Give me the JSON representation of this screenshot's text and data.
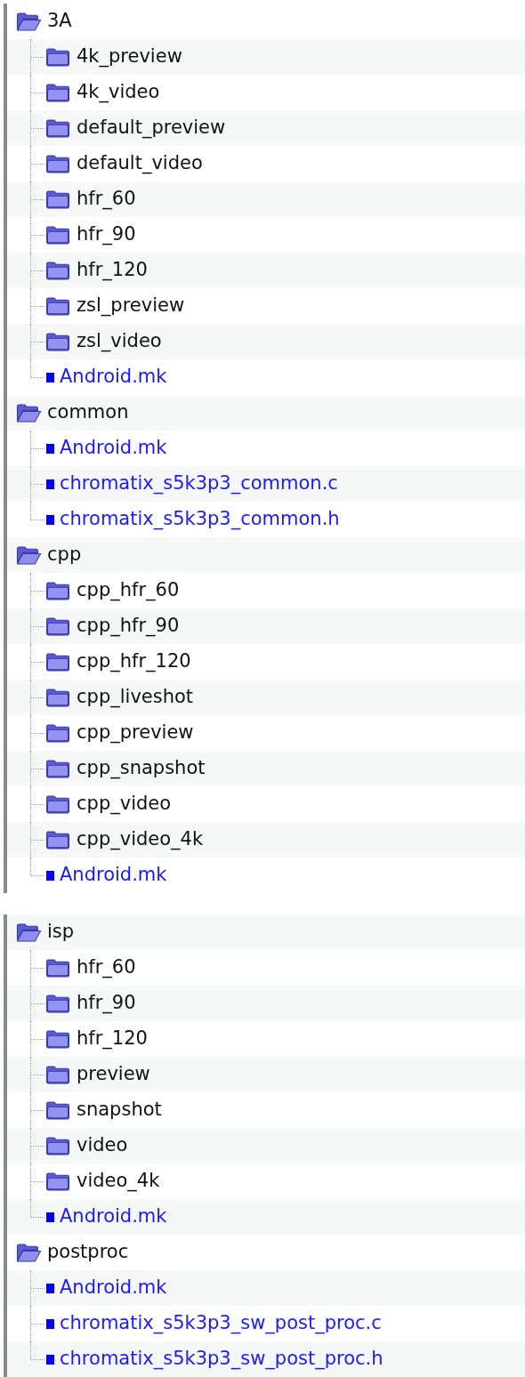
{
  "panels": [
    {
      "items": [
        {
          "name": "3A",
          "kind": "folder",
          "expanded": true,
          "children": [
            {
              "name": "4k_preview",
              "kind": "folder",
              "expanded": false
            },
            {
              "name": "4k_video",
              "kind": "folder",
              "expanded": false
            },
            {
              "name": "default_preview",
              "kind": "folder",
              "expanded": false
            },
            {
              "name": "default_video",
              "kind": "folder",
              "expanded": false
            },
            {
              "name": "hfr_60",
              "kind": "folder",
              "expanded": false
            },
            {
              "name": "hfr_90",
              "kind": "folder",
              "expanded": false
            },
            {
              "name": "hfr_120",
              "kind": "folder",
              "expanded": false
            },
            {
              "name": "zsl_preview",
              "kind": "folder",
              "expanded": false
            },
            {
              "name": "zsl_video",
              "kind": "folder",
              "expanded": false
            },
            {
              "name": "Android.mk",
              "kind": "file"
            }
          ]
        },
        {
          "name": "common",
          "kind": "folder",
          "expanded": true,
          "children": [
            {
              "name": "Android.mk",
              "kind": "file"
            },
            {
              "name": "chromatix_s5k3p3_common.c",
              "kind": "file"
            },
            {
              "name": "chromatix_s5k3p3_common.h",
              "kind": "file"
            }
          ]
        },
        {
          "name": "cpp",
          "kind": "folder",
          "expanded": true,
          "children": [
            {
              "name": "cpp_hfr_60",
              "kind": "folder",
              "expanded": false
            },
            {
              "name": "cpp_hfr_90",
              "kind": "folder",
              "expanded": false
            },
            {
              "name": "cpp_hfr_120",
              "kind": "folder",
              "expanded": false
            },
            {
              "name": "cpp_liveshot",
              "kind": "folder",
              "expanded": false
            },
            {
              "name": "cpp_preview",
              "kind": "folder",
              "expanded": false
            },
            {
              "name": "cpp_snapshot",
              "kind": "folder",
              "expanded": false
            },
            {
              "name": "cpp_video",
              "kind": "folder",
              "expanded": false
            },
            {
              "name": "cpp_video_4k",
              "kind": "folder",
              "expanded": false
            },
            {
              "name": "Android.mk",
              "kind": "file"
            }
          ]
        }
      ]
    },
    {
      "items": [
        {
          "name": "isp",
          "kind": "folder",
          "expanded": true,
          "children": [
            {
              "name": "hfr_60",
              "kind": "folder",
              "expanded": false
            },
            {
              "name": "hfr_90",
              "kind": "folder",
              "expanded": false
            },
            {
              "name": "hfr_120",
              "kind": "folder",
              "expanded": false
            },
            {
              "name": "preview",
              "kind": "folder",
              "expanded": false
            },
            {
              "name": "snapshot",
              "kind": "folder",
              "expanded": false
            },
            {
              "name": "video",
              "kind": "folder",
              "expanded": false
            },
            {
              "name": "video_4k",
              "kind": "folder",
              "expanded": false
            },
            {
              "name": "Android.mk",
              "kind": "file"
            }
          ]
        },
        {
          "name": "postproc",
          "kind": "folder",
          "expanded": true,
          "children": [
            {
              "name": "Android.mk",
              "kind": "file"
            },
            {
              "name": "chromatix_s5k3p3_sw_post_proc.c",
              "kind": "file"
            },
            {
              "name": "chromatix_s5k3p3_sw_post_proc.h",
              "kind": "file"
            }
          ]
        }
      ]
    }
  ]
}
